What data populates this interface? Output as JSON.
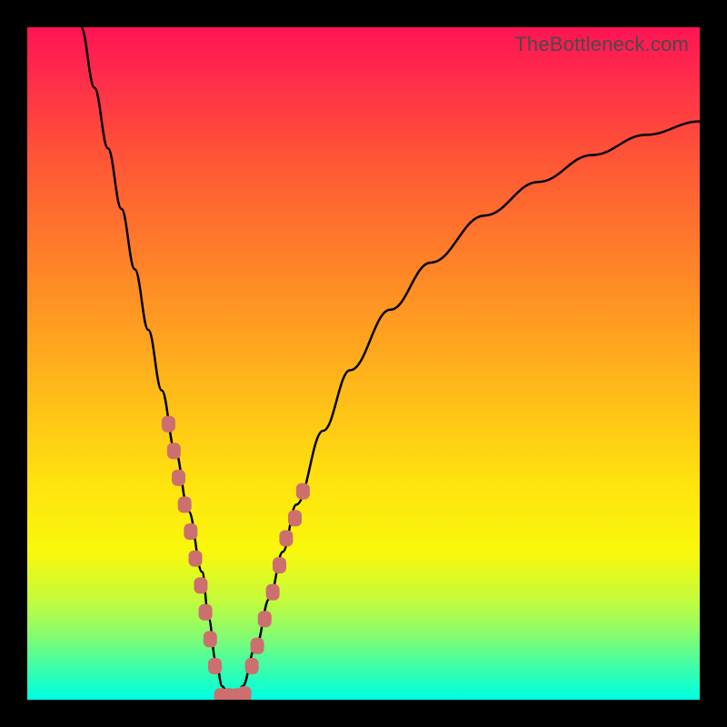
{
  "watermark": "TheBottleneck.com",
  "chart_data": {
    "type": "line",
    "title": "",
    "xlabel": "",
    "ylabel": "",
    "xlim": [
      0,
      100
    ],
    "ylim": [
      0,
      100
    ],
    "grid": false,
    "legend": false,
    "background": "rainbow-gradient (red top → green bottom)",
    "series": [
      {
        "name": "bottleneck-v-curve",
        "color": "#000000",
        "x": [
          8,
          10,
          12,
          14,
          16,
          18,
          20,
          22,
          24,
          26,
          27,
          28,
          29,
          30,
          31,
          32,
          34,
          36,
          38,
          40,
          44,
          48,
          54,
          60,
          68,
          76,
          84,
          92,
          100
        ],
        "y": [
          100,
          91,
          82,
          73,
          64,
          55,
          46,
          37,
          28,
          19,
          12,
          6,
          2,
          0,
          0,
          2,
          8,
          15,
          22,
          29,
          40,
          49,
          58,
          65,
          72,
          77,
          81,
          84,
          86
        ]
      }
    ],
    "markers": [
      {
        "name": "left-branch-dots",
        "type": "scatter",
        "color": "#cc6f6f",
        "shape": "rounded-rect",
        "x": [
          21.0,
          21.8,
          22.5,
          23.4,
          24.3,
          25.0,
          25.8,
          26.5,
          27.2,
          27.9
        ],
        "y": [
          41,
          37,
          33,
          29,
          25,
          21,
          17,
          13,
          9,
          5
        ]
      },
      {
        "name": "bottom-dots",
        "type": "scatter",
        "color": "#cc6f6f",
        "shape": "rounded-rect",
        "x": [
          28.8,
          30.0,
          31.2,
          32.3
        ],
        "y": [
          0.5,
          0.5,
          0.5,
          0.8
        ]
      },
      {
        "name": "right-branch-dots",
        "type": "scatter",
        "color": "#cc6f6f",
        "shape": "rounded-rect",
        "x": [
          33.4,
          34.2,
          35.3,
          36.5,
          37.5,
          38.5,
          39.8,
          41.0
        ],
        "y": [
          5,
          8,
          12,
          16,
          20,
          24,
          27,
          31
        ]
      }
    ]
  }
}
